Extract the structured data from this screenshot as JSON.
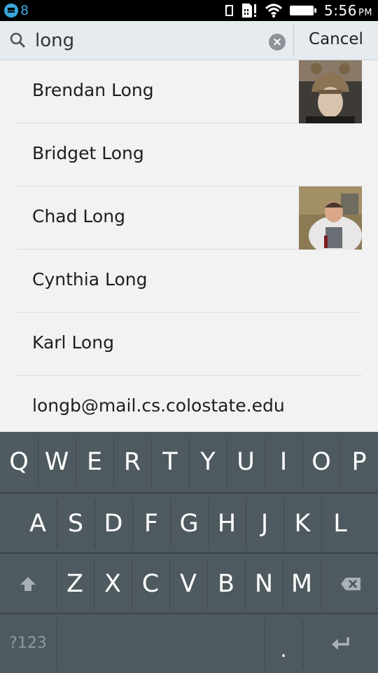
{
  "status_bar": {
    "notification_count": "8",
    "time": "5:56",
    "ampm": "PM"
  },
  "search": {
    "value": "long",
    "cancel_label": "Cancel"
  },
  "results": [
    {
      "name": "Brendan Long",
      "has_photo": true
    },
    {
      "name": "Bridget Long",
      "has_photo": false
    },
    {
      "name": "Chad Long",
      "has_photo": true
    },
    {
      "name": "Cynthia Long",
      "has_photo": false
    },
    {
      "name": "Karl Long",
      "has_photo": false
    },
    {
      "name": "longb@mail.cs.colostate.edu",
      "has_photo": false
    }
  ],
  "keyboard": {
    "row1": [
      "Q",
      "W",
      "E",
      "R",
      "T",
      "Y",
      "U",
      "I",
      "O",
      "P"
    ],
    "row2": [
      "A",
      "S",
      "D",
      "F",
      "G",
      "H",
      "J",
      "K",
      "L"
    ],
    "row3": [
      "Z",
      "X",
      "C",
      "V",
      "B",
      "N",
      "M"
    ],
    "symbols_label": "?123",
    "period_label": "."
  },
  "colors": {
    "keyboard_bg": "#4f5a60",
    "header_bg": "#e6ebef",
    "accent": "#3aa6dd"
  }
}
